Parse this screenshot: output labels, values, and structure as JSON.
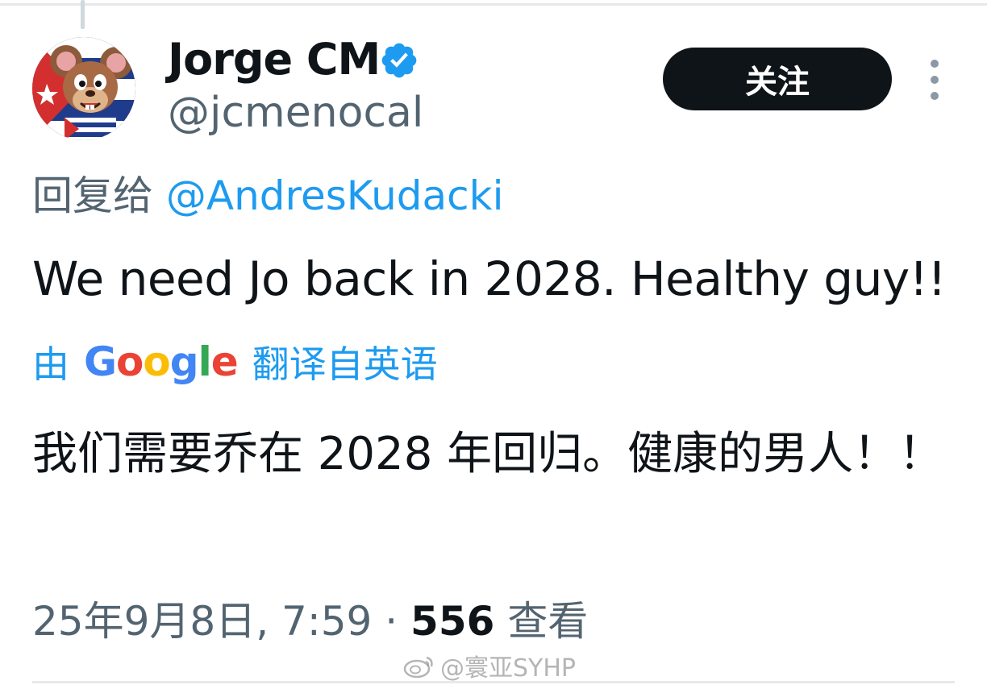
{
  "author": {
    "display_name": "Jorge CM",
    "handle": "@jcmenocal",
    "verified": true
  },
  "follow_button": {
    "label": "关注"
  },
  "reply": {
    "prefix": "回复给",
    "mention": "@AndresKudacki"
  },
  "tweet": {
    "text": "We need Jo back in 2028. Healthy guy!!"
  },
  "translation": {
    "prefix": "由",
    "google": [
      "G",
      "o",
      "o",
      "g",
      "l",
      "e"
    ],
    "suffix": "翻译自英语",
    "text": "我们需要乔在 2028 年回归。健康的男人！！"
  },
  "meta": {
    "datetime": "25年9月8日, 7:59",
    "separator": "·",
    "views": "556",
    "views_label": "查看"
  },
  "watermark": {
    "text": "@寰亚SYHP"
  },
  "colors": {
    "accent": "#1d9bf0",
    "secondary_text": "#536471",
    "primary_text": "#0f1419"
  },
  "icons": {
    "verified": "verified-badge-icon",
    "more": "more-vertical-icon",
    "watermark": "weibo-icon"
  }
}
